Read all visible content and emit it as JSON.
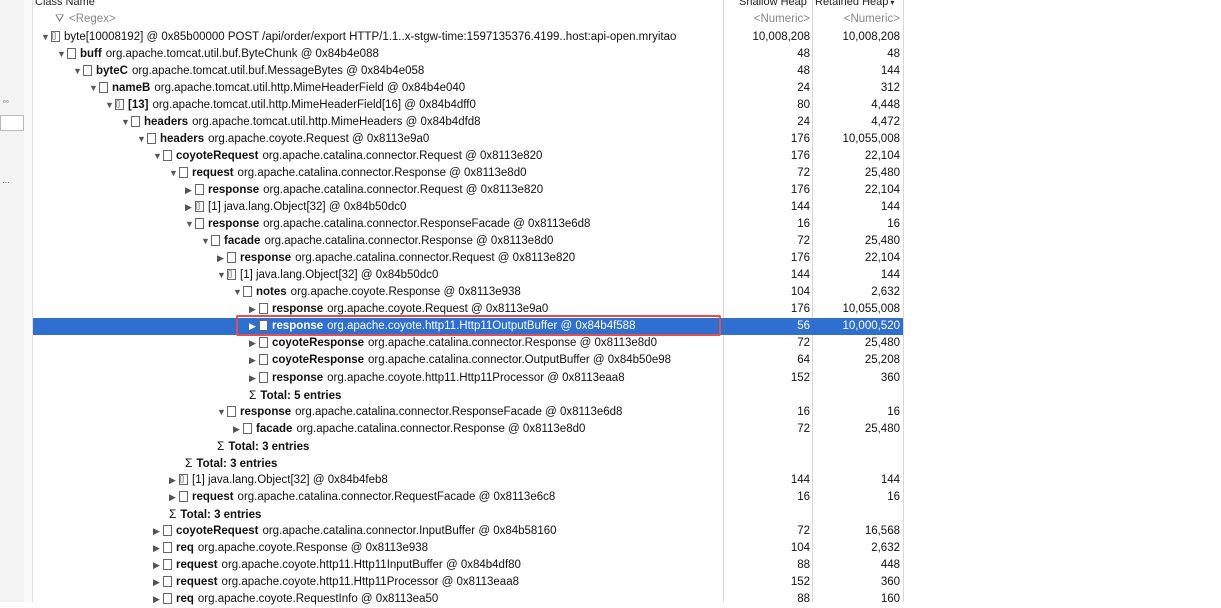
{
  "columns": {
    "class_name": "Class Name",
    "shallow_heap": "Shallow Heap",
    "retained_heap": "Retained Heap"
  },
  "filter": {
    "name_placeholder": "<Regex>",
    "shallow_placeholder": "<Numeric>",
    "retained_placeholder": "<Numeric>"
  },
  "rows": [
    {
      "depth": 0,
      "toggle": "down",
      "icon": "arr",
      "label": "",
      "text": "byte[10008192] @ 0x85b00000  POST /api/order/export HTTP/1.1..x-stgw-time:1597135376.4199..host:api-open.mryitao",
      "shallow": "10,008,208",
      "retained": "10,008,208"
    },
    {
      "depth": 1,
      "toggle": "down",
      "icon": "obj",
      "label": "buff",
      "text": "org.apache.tomcat.util.buf.ByteChunk @ 0x84b4e088",
      "shallow": "48",
      "retained": "48"
    },
    {
      "depth": 2,
      "toggle": "down",
      "icon": "obj",
      "label": "byteC",
      "text": "org.apache.tomcat.util.buf.MessageBytes @ 0x84b4e058",
      "shallow": "48",
      "retained": "144"
    },
    {
      "depth": 3,
      "toggle": "down",
      "icon": "obj",
      "label": "nameB",
      "text": "org.apache.tomcat.util.http.MimeHeaderField @ 0x84b4e040",
      "shallow": "24",
      "retained": "312"
    },
    {
      "depth": 4,
      "toggle": "down",
      "icon": "arr",
      "label": "[13]",
      "text": "org.apache.tomcat.util.http.MimeHeaderField[16] @ 0x84b4dff0",
      "shallow": "80",
      "retained": "4,448"
    },
    {
      "depth": 5,
      "toggle": "down",
      "icon": "obj",
      "label": "headers",
      "text": "org.apache.tomcat.util.http.MimeHeaders @ 0x84b4dfd8",
      "shallow": "24",
      "retained": "4,472"
    },
    {
      "depth": 6,
      "toggle": "down",
      "icon": "obj",
      "label": "headers",
      "text": "org.apache.coyote.Request @ 0x8113e9a0",
      "shallow": "176",
      "retained": "10,055,008"
    },
    {
      "depth": 7,
      "toggle": "down",
      "icon": "obj",
      "label": "coyoteRequest",
      "text": "org.apache.catalina.connector.Request @ 0x8113e820",
      "shallow": "176",
      "retained": "22,104"
    },
    {
      "depth": 8,
      "toggle": "down",
      "icon": "obj",
      "label": "request",
      "text": "org.apache.catalina.connector.Response @ 0x8113e8d0",
      "shallow": "72",
      "retained": "25,480"
    },
    {
      "depth": 9,
      "toggle": "right",
      "icon": "obj",
      "label": "response",
      "text": "org.apache.catalina.connector.Request @ 0x8113e820",
      "shallow": "176",
      "retained": "22,104"
    },
    {
      "depth": 9,
      "toggle": "right",
      "icon": "arr",
      "label": "",
      "text": "[1] java.lang.Object[32] @ 0x84b50dc0",
      "shallow": "144",
      "retained": "144"
    },
    {
      "depth": 9,
      "toggle": "down",
      "icon": "obj",
      "label": "response",
      "text": "org.apache.catalina.connector.ResponseFacade @ 0x8113e6d8",
      "shallow": "16",
      "retained": "16"
    },
    {
      "depth": 10,
      "toggle": "down",
      "icon": "obj",
      "label": "facade",
      "text": "org.apache.catalina.connector.Response @ 0x8113e8d0",
      "shallow": "72",
      "retained": "25,480"
    },
    {
      "depth": 11,
      "toggle": "right",
      "icon": "obj",
      "label": "response",
      "text": "org.apache.catalina.connector.Request @ 0x8113e820",
      "shallow": "176",
      "retained": "22,104"
    },
    {
      "depth": 11,
      "toggle": "down",
      "icon": "arr",
      "label": "",
      "text": "[1] java.lang.Object[32] @ 0x84b50dc0",
      "shallow": "144",
      "retained": "144"
    },
    {
      "depth": 12,
      "toggle": "down",
      "icon": "obj",
      "label": "notes",
      "text": "org.apache.coyote.Response @ 0x8113e938",
      "shallow": "104",
      "retained": "2,632"
    },
    {
      "depth": 13,
      "toggle": "right",
      "icon": "obj",
      "label": "response",
      "text": "org.apache.coyote.Request @ 0x8113e9a0",
      "shallow": "176",
      "retained": "10,055,008"
    },
    {
      "depth": 13,
      "toggle": "right",
      "icon": "obj",
      "label": "response",
      "text": "org.apache.coyote.http11.Http11OutputBuffer @ 0x84b4f588",
      "shallow": "56",
      "retained": "10,000,520",
      "selected": true
    },
    {
      "depth": 13,
      "toggle": "right",
      "icon": "obj",
      "label": "coyoteResponse",
      "text": "org.apache.catalina.connector.Response @ 0x8113e8d0",
      "shallow": "72",
      "retained": "25,480"
    },
    {
      "depth": 13,
      "toggle": "right",
      "icon": "obj",
      "label": "coyoteResponse",
      "text": "org.apache.catalina.connector.OutputBuffer @ 0x84b50e98",
      "shallow": "64",
      "retained": "25,208"
    },
    {
      "depth": 13,
      "toggle": "right",
      "icon": "obj",
      "label": "response",
      "text": "org.apache.coyote.http11.Http11Processor @ 0x8113eaa8",
      "shallow": "152",
      "retained": "360"
    },
    {
      "depth": 13,
      "total": true,
      "text": "Total: 5 entries"
    },
    {
      "depth": 11,
      "toggle": "down",
      "icon": "obj",
      "label": "response",
      "text": "org.apache.catalina.connector.ResponseFacade @ 0x8113e6d8",
      "shallow": "16",
      "retained": "16"
    },
    {
      "depth": 12,
      "toggle": "right",
      "icon": "obj",
      "label": "facade",
      "text": "org.apache.catalina.connector.Response @ 0x8113e8d0",
      "shallow": "72",
      "retained": "25,480"
    },
    {
      "depth": 11,
      "total": true,
      "text": "Total: 3 entries"
    },
    {
      "depth": 9,
      "total": true,
      "text": "Total: 3 entries"
    },
    {
      "depth": 8,
      "toggle": "right",
      "icon": "arr",
      "label": "",
      "text": "[1] java.lang.Object[32] @ 0x84b4feb8",
      "shallow": "144",
      "retained": "144"
    },
    {
      "depth": 8,
      "toggle": "right",
      "icon": "obj",
      "label": "request",
      "text": "org.apache.catalina.connector.RequestFacade @ 0x8113e6c8",
      "shallow": "16",
      "retained": "16"
    },
    {
      "depth": 8,
      "total": true,
      "text": "Total: 3 entries"
    },
    {
      "depth": 7,
      "toggle": "right",
      "icon": "obj",
      "label": "coyoteRequest",
      "text": "org.apache.catalina.connector.InputBuffer @ 0x84b58160",
      "shallow": "72",
      "retained": "16,568"
    },
    {
      "depth": 7,
      "toggle": "right",
      "icon": "obj",
      "label": "req",
      "text": "org.apache.coyote.Response @ 0x8113e938",
      "shallow": "104",
      "retained": "2,632"
    },
    {
      "depth": 7,
      "toggle": "right",
      "icon": "obj",
      "label": "request",
      "text": "org.apache.coyote.http11.Http11InputBuffer @ 0x84b4df80",
      "shallow": "88",
      "retained": "448"
    },
    {
      "depth": 7,
      "toggle": "right",
      "icon": "obj",
      "label": "request",
      "text": "org.apache.coyote.http11.Http11Processor @ 0x8113eaa8",
      "shallow": "152",
      "retained": "360"
    },
    {
      "depth": 7,
      "toggle": "right",
      "icon": "obj",
      "label": "req",
      "text": "org.apache.coyote.RequestInfo @ 0x8113ea50",
      "shallow": "88",
      "retained": "160"
    }
  ]
}
